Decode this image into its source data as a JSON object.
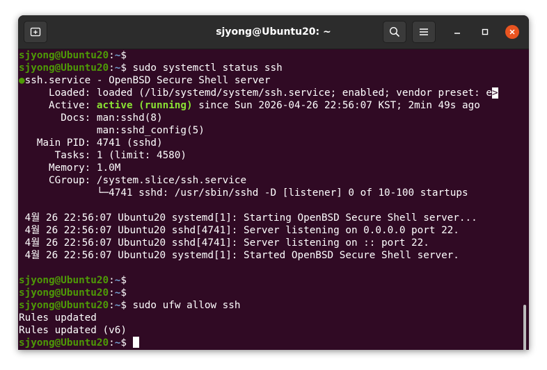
{
  "window": {
    "title": "sjyong@Ubuntu20: ~"
  },
  "colors": {
    "terminal_bg": "#300a24",
    "titlebar_bg": "#2c2c2c",
    "prompt_user": "#4e9a06",
    "prompt_path": "#729fcf",
    "active_green": "#8ae234",
    "close_button": "#e95420"
  },
  "icons": {
    "new_tab": "new-tab-icon",
    "search": "search-icon",
    "menu": "hamburger-menu-icon",
    "minimize": "minimize-icon",
    "maximize": "maximize-icon",
    "close": "close-icon"
  },
  "prompt": {
    "user_host": "sjyong@Ubuntu20",
    "colon": ":",
    "path": "~",
    "symbol": "$"
  },
  "terminal": {
    "cmd1": "",
    "cmd2": " sudo systemctl status ssh",
    "service_dot": "●",
    "service_line": "ssh.service - OpenBSD Secure Shell server",
    "loaded_line": "     Loaded: loaded (/lib/systemd/system/ssh.service; enabled; vendor preset: e",
    "loaded_overflow": ">",
    "active_label": "     Active: ",
    "active_state": "active (running)",
    "active_rest": " since Sun 2026-04-26 22:56:07 KST; 2min 49s ago",
    "docs_1": "       Docs: man:sshd(8)",
    "docs_2": "             man:sshd_config(5)",
    "main_pid": "   Main PID: 4741 (sshd)",
    "tasks": "      Tasks: 1 (limit: 4580)",
    "memory": "     Memory: 1.0M",
    "cgroup": "     CGroup: /system.slice/ssh.service",
    "cgroup_child": "             └─4741 sshd: /usr/sbin/sshd -D [listener] 0 of 10-100 startups",
    "log_1": " 4월 26 22:56:07 Ubuntu20 systemd[1]: Starting OpenBSD Secure Shell server...",
    "log_2": " 4월 26 22:56:07 Ubuntu20 sshd[4741]: Server listening on 0.0.0.0 port 22.",
    "log_3": " 4월 26 22:56:07 Ubuntu20 sshd[4741]: Server listening on :: port 22.",
    "log_4": " 4월 26 22:56:07 Ubuntu20 systemd[1]: Started OpenBSD Secure Shell server.",
    "cmd3": "",
    "cmd4": "",
    "cmd5": " sudo ufw allow ssh",
    "out_1": "Rules updated",
    "out_2": "Rules updated (v6)",
    "cmd6": " "
  }
}
